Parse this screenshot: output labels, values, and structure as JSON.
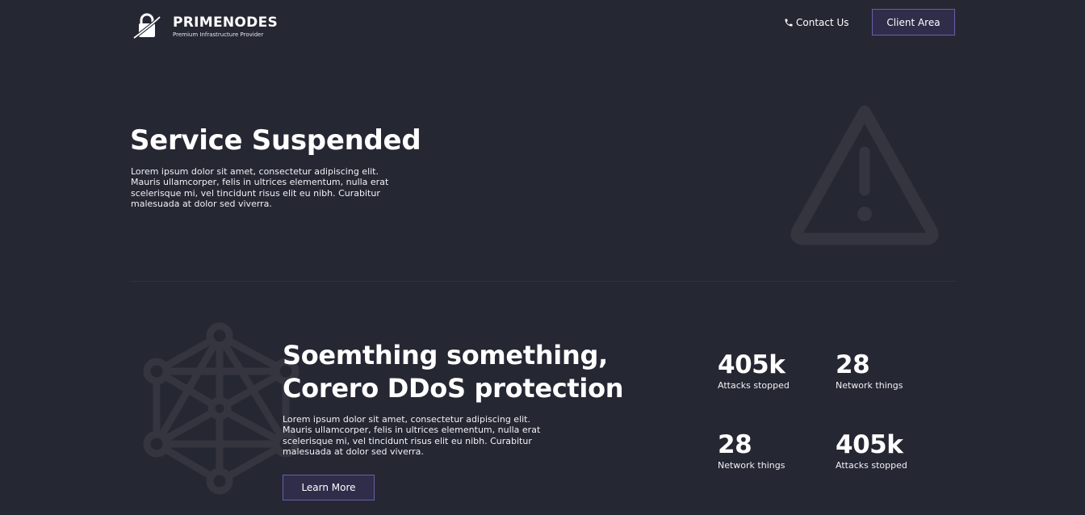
{
  "colors": {
    "background": "#252733",
    "accent_border": "#6a5fa8",
    "button_fill": "#2f2d49",
    "icon_muted": "#34353f"
  },
  "header": {
    "brand_name": "PRIMENODES",
    "brand_tagline": "Premium Infrastructure Provider",
    "logo_icon": "padlock-orbit-icon",
    "contact_icon": "phone-icon",
    "contact_label": "Contact Us",
    "client_area_label": "Client Area"
  },
  "hero": {
    "title": "Service Suspended",
    "text": "Lorem ipsum dolor sit amet, consectetur adipiscing elit. Mauris ullamcorper, felis in ultrices elementum, nulla erat scelerisque mi, vel tincidunt risus elit eu nibh. Curabitur malesuada at dolor sed viverra.",
    "icon": "warning-triangle-icon"
  },
  "ddos": {
    "icon": "network-icon",
    "title_line1": "Soemthing something,",
    "title_line2": "Corero DDoS protection",
    "text": "Lorem ipsum dolor sit amet, consectetur adipiscing elit. Mauris ullamcorper, felis in ultrices elementum, nulla erat scelerisque mi, vel tincidunt risus elit eu nibh. Curabitur malesuada at dolor sed viverra.",
    "button_label": "Learn More",
    "stats": [
      {
        "value": "405k",
        "label": "Attacks stopped"
      },
      {
        "value": "28",
        "label": "Network things"
      },
      {
        "value": "28",
        "label": "Network things"
      },
      {
        "value": "405k",
        "label": "Attacks stopped"
      }
    ]
  }
}
